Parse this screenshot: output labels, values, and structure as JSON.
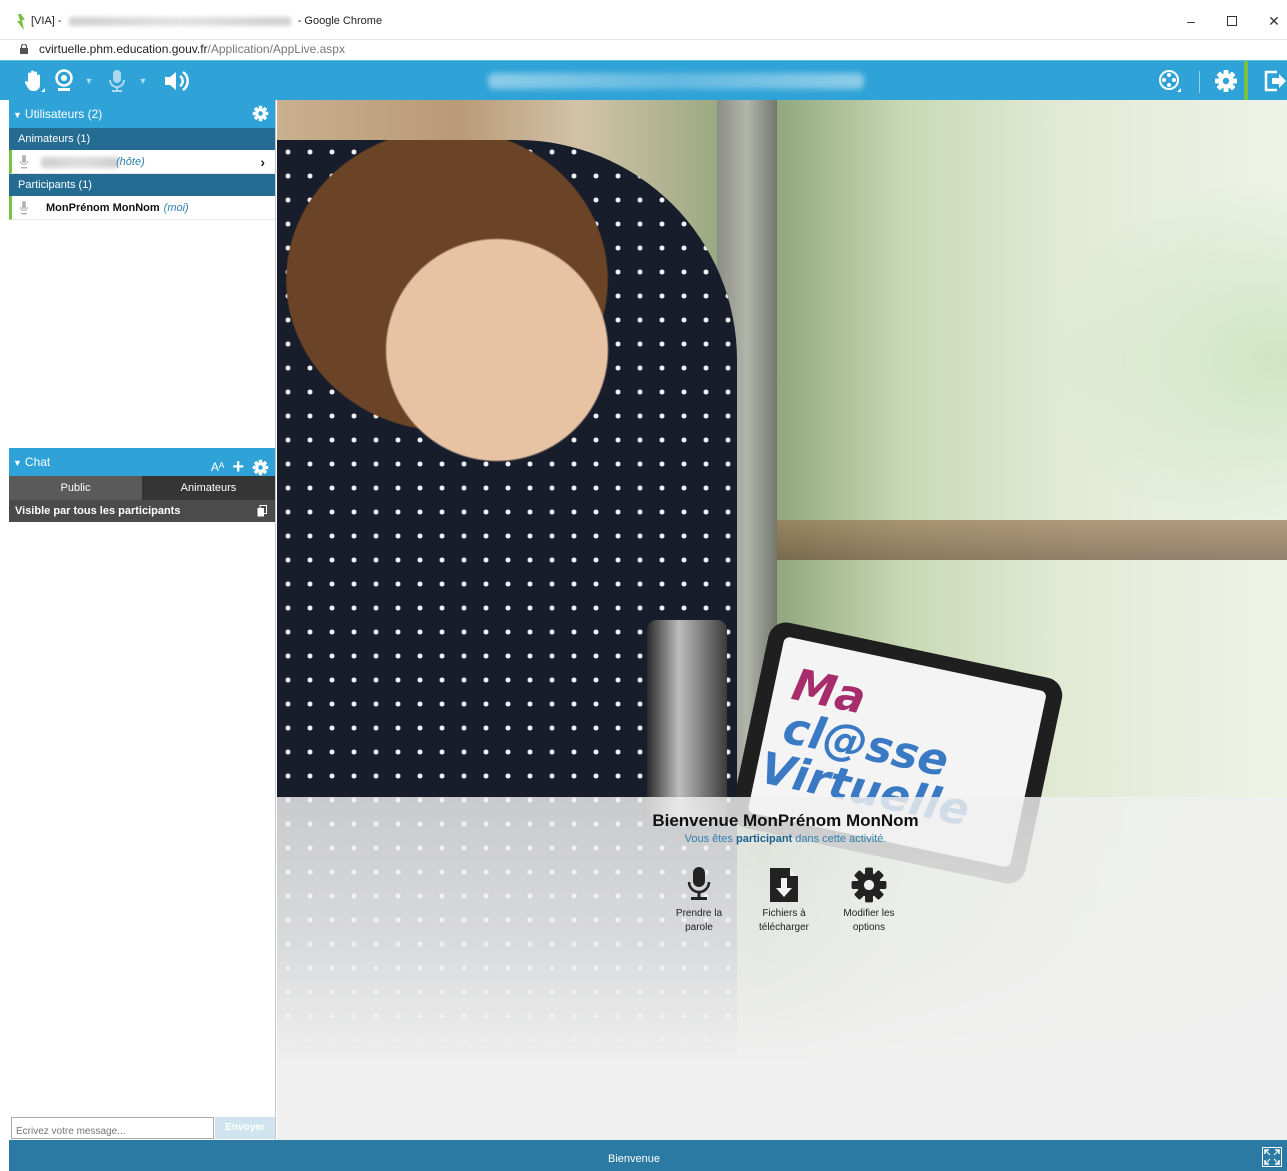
{
  "browser": {
    "title_prefix": "[VIA] -",
    "title_suffix": "- Google Chrome",
    "url_host": "cvirtuelle.phm.education.gouv.fr",
    "url_path": "/Application/AppLive.aspx",
    "minimize_glyph": "–",
    "close_glyph": "✕"
  },
  "toolbar": {
    "caret_glyph": "▼",
    "colors": {
      "toolbar_bg": "#2fa3d7",
      "accent_green": "#7bc142"
    }
  },
  "users_panel": {
    "title": "Utilisateurs (2)",
    "collapse_glyph": "▼",
    "groups": [
      {
        "label": "Animateurs (1)",
        "users": [
          {
            "role": "(hôte)",
            "chevron": "›"
          }
        ]
      },
      {
        "label": "Participants (1)",
        "users": [
          {
            "name": "MonPrénom MonNom",
            "tag": "(moi)"
          }
        ]
      }
    ]
  },
  "chat": {
    "title": "Chat",
    "collapse_glyph": "▼",
    "font_size_label": "Aᴬ",
    "add_glyph": "+",
    "tabs": [
      {
        "label": "Public",
        "active": true
      },
      {
        "label": "Animateurs",
        "active": false
      }
    ],
    "visibility_text": "Visible par tous les participants",
    "input_placeholder": "Écrivez votre message...",
    "send_label": "Envoyer"
  },
  "stage": {
    "tablet_line1_ma": "Ma",
    "tablet_line1_rest": " cl@sse",
    "tablet_line2": "Virtuelle",
    "welcome_title": "Bienvenue MonPrénom MonNom",
    "welcome_sub_before": "Vous êtes ",
    "welcome_sub_role": "participant",
    "welcome_sub_after": " dans cette activité.",
    "actions": [
      {
        "label_line1": "Prendre la",
        "label_line2": "parole",
        "icon": "microphone-icon"
      },
      {
        "label_line1": "Fichiers à",
        "label_line2": "télécharger",
        "icon": "file-download-icon"
      },
      {
        "label_line1": "Modifier les",
        "label_line2": "options",
        "icon": "gear-icon"
      }
    ],
    "collapse_handle_glyph": "◂"
  },
  "bottombar": {
    "label": "Bienvenue",
    "color": "#2a7aa3"
  }
}
